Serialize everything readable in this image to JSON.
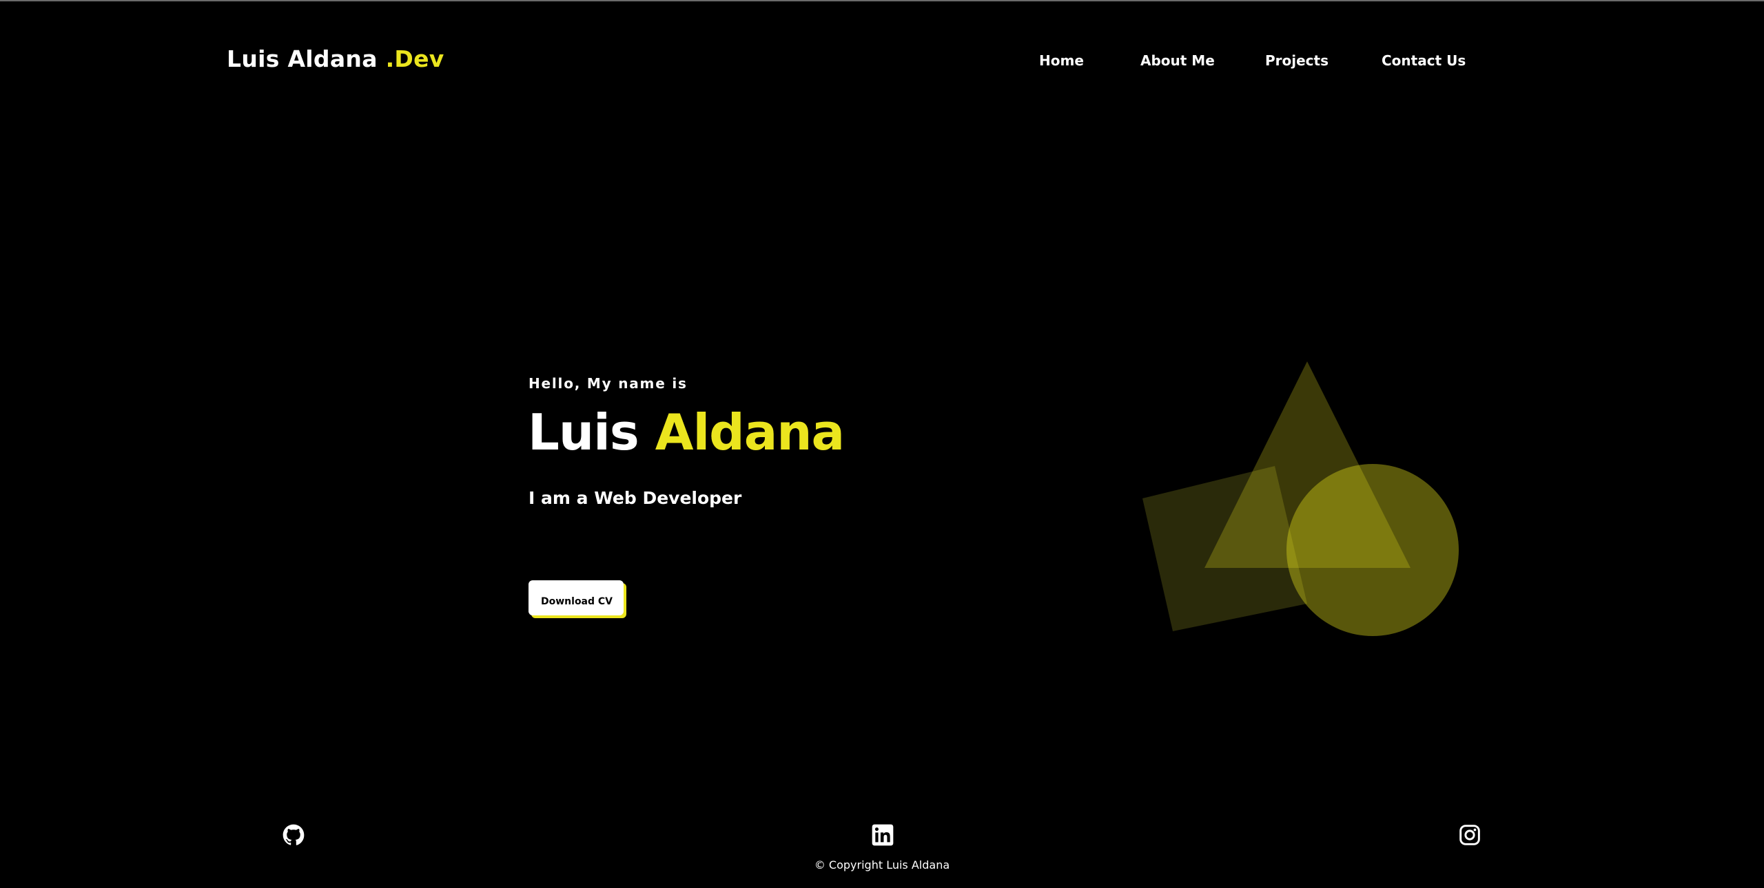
{
  "header": {
    "brand_name": "Luis Aldana",
    "brand_suffix": ".Dev",
    "nav": {
      "home": "Home",
      "about": "About Me",
      "projects": "Projects",
      "contact": "Contact Us"
    }
  },
  "hero": {
    "greeting": "Hello, My name is",
    "first_name": "Luis",
    "last_name": "Aldana",
    "role": "I am a Web Developer",
    "cta_label": "Download CV"
  },
  "footer": {
    "social": {
      "github": "github-icon",
      "linkedin": "linkedin-icon",
      "instagram": "instagram-icon"
    },
    "copyright": "© Copyright Luis Aldana"
  },
  "colors": {
    "background": "#000000",
    "accent": "#ebe51e",
    "text": "#ffffff"
  }
}
